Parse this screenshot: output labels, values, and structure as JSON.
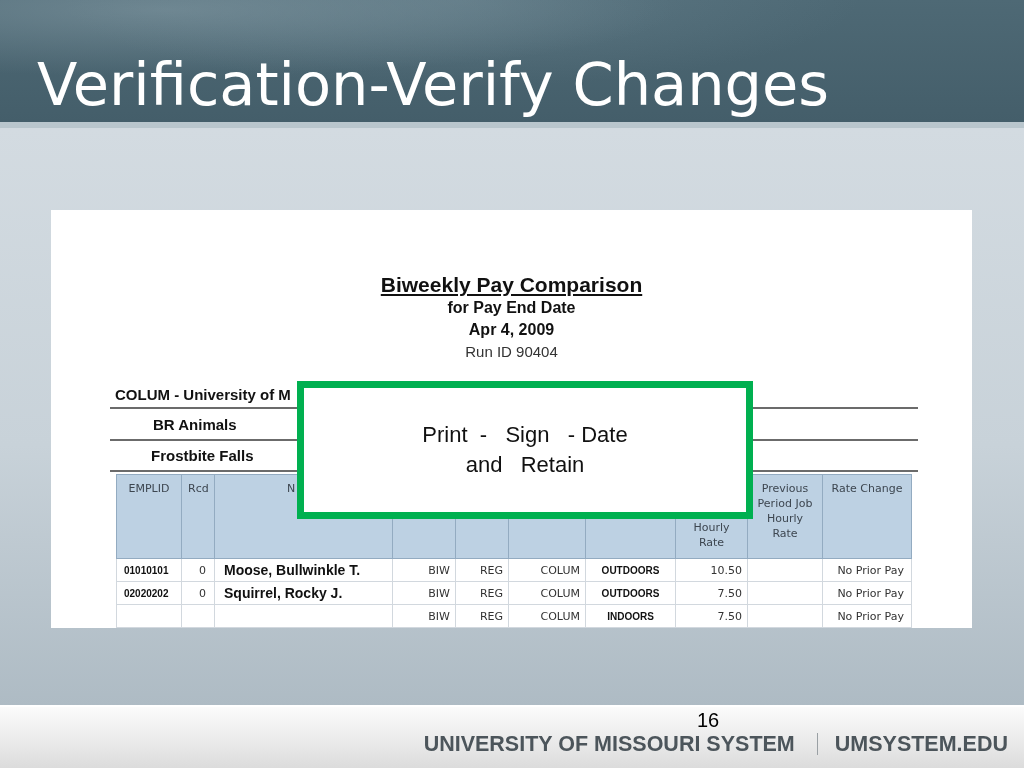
{
  "slide": {
    "title": "Verification-Verify Changes",
    "page_number": "16"
  },
  "report": {
    "title": "Biweekly Pay Comparison",
    "subtitle": "for Pay End Date",
    "date": "Apr 4, 2009",
    "run_id": "Run ID 90404",
    "business_unit": "COLUM - University of M",
    "department": "BR Animals",
    "location": "Frostbite Falls",
    "table": {
      "headings": {
        "emplid": "EMPLID",
        "rcd": "Rcd",
        "name": "N",
        "hourly_rate": "Hourly Rate",
        "previous_rate": "Previous Period Job Hourly Rate",
        "rate_change": "Rate Change"
      },
      "rows": [
        {
          "emplid": "01010101",
          "rcd": "0",
          "name": "Moose, Bullwinkle T.",
          "column_4": "BIW",
          "column_5": "REG",
          "column_6": "COLUM",
          "column_7": "OUTDOORS",
          "hourly_rate": "10.50",
          "rate_change": "No Prior Pay"
        },
        {
          "emplid": "02020202",
          "rcd": "0",
          "name": "Squirrel, Rocky J.",
          "column_4": "BIW",
          "column_5": "REG",
          "column_6": "COLUM",
          "column_7": "OUTDOORS",
          "hourly_rate": "7.50",
          "rate_change": "No Prior Pay"
        },
        {
          "column_4": "BIW",
          "column_5": "REG",
          "column_6": "COLUM",
          "column_7": "INDOORS",
          "hourly_rate": "7.50",
          "rate_change": "No Prior Pay"
        }
      ]
    }
  },
  "callout": {
    "text": "Print  -   Sign   - Date\nand   Retain"
  },
  "footer": {
    "organization": "UNIVERSITY OF MISSOURI SYSTEM",
    "website": "UMSYSTEM.EDU"
  }
}
